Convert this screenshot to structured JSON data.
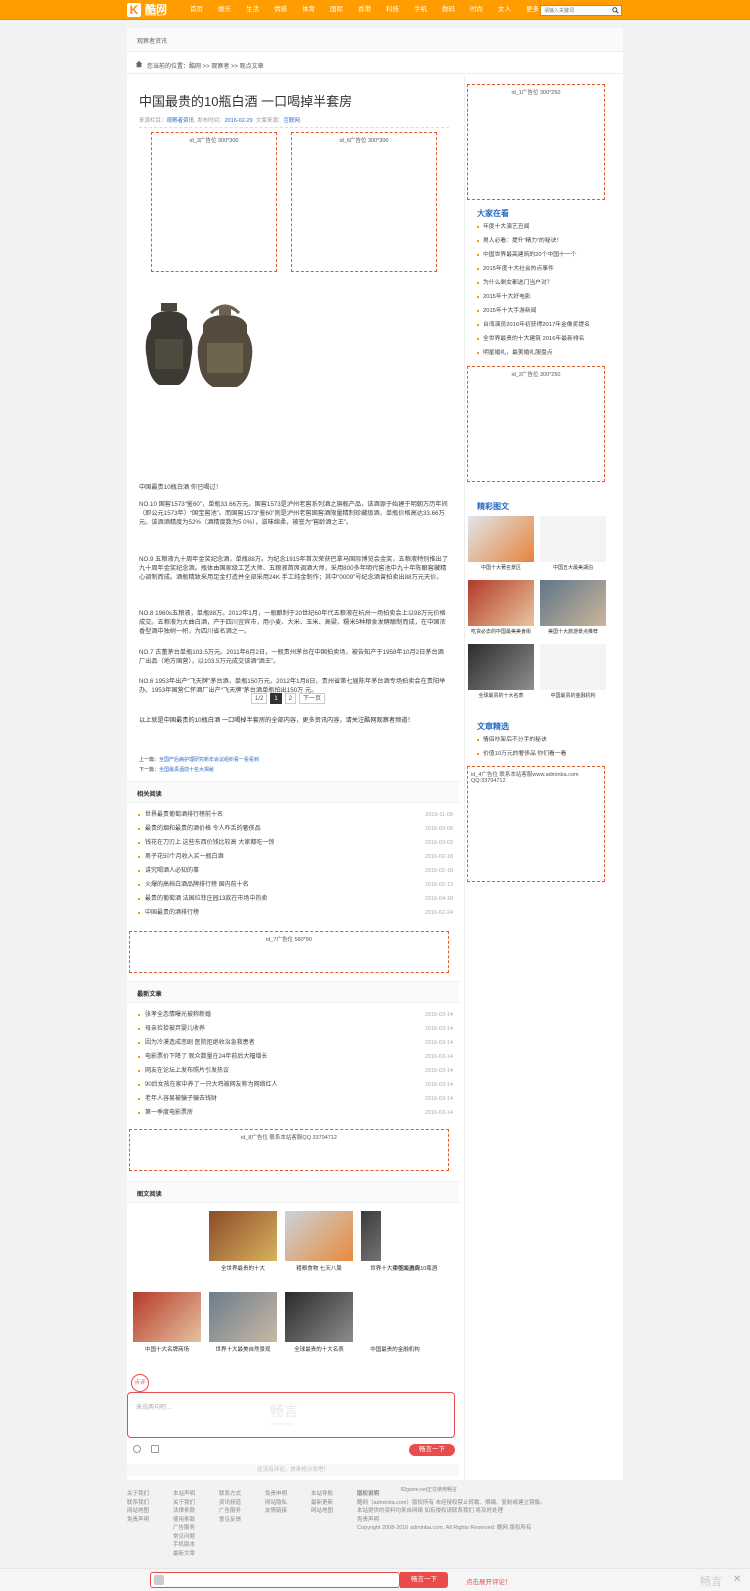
{
  "header": {
    "logo_mark": "K",
    "logo_text": "酷网",
    "logo_sub": "kuwoli.com",
    "nav": [
      "首页",
      "娱乐",
      "生活",
      "情感",
      "体育",
      "国际",
      "香港",
      "科技",
      "手机",
      "数码",
      "时尚",
      "女人",
      "更多 ▾"
    ],
    "search_placeholder": "请输入关键词"
  },
  "breadcrumb_bar": "观察者资讯",
  "position": "您当前的位置：酷网 >> 观察者 >> 观点文章",
  "article": {
    "title": "中国最贵的10瓶白酒 一口喝掉半套房",
    "meta_pre": "来源栏目：",
    "meta_column": "观察者资讯",
    "meta_mid": "发布时间：",
    "meta_date": "2016-02-29",
    "meta_src_label": "文章来源：",
    "meta_src": "互联网",
    "ad_left": "id_3广告位 300*300",
    "ad_right": "id_6广告位 300*300",
    "paragraphs": [
      "中国最贵10瓶白酒 你已喝过！",
      "NO.10 国窖1573“鉴60”，单瓶33.66万元。国窖1573是泸州老窖系列酒之旗舰产品，该酒源于始建于明朝万历年间（即公元1573年）“国宝窖池”。而国窖1573“鉴60”则是泸州老窖国窖酒限量精制珍藏级酒，单瓶价格高达33.66万元。该酒酒精度为52%（酒精度数为5 0%），滋味绵柔，被誉为“窖龄酒之王”。",
      "NO.9 五粮液九十周年金奖纪念酒，单瓶88万。为纪念1915年首次荣获巴拿马国际博览会金奖，五粮液特别推出了九十周年金奖纪念酒。瓶体由国家级工艺大师、五粮液首席调酒大师，采用800多年明代窖池中九十年陈酿窖藏精心调制而成。酒瓶精致采用足金打造并全部采用24K 手工纯金制作；其中“0009”号纪念酒曾拍卖出88万元天价。",
      "NO.8 1960s五粮液，单瓶98万。2012年1月，一瓶酿制于20世纪60年代五粮液在杭州一场拍卖会上以98万元价格成交。五粮液为大曲白酒，产于四川宜宾市，用小麦、大米、玉米、高粱、糯米5种粮食发酵酿制而成，在中国浓香型酒中独树一帜，为四川省名酒之一。",
      "NO.7 古董茅台单瓶103.5万元。2011年6月2日，一瓶贵州茅台在中国拍卖场，被告知产于1958年10月2日茅台酒厂出品（地方国营），以103.5万元成交该酒“酒王”。",
      "NO.6 1953年出产“飞天牌”茅台酒，单瓶150万元。2012年1月8日，贵州省第七届陈年茅台酒专场拍卖会在贵阳举办。1953年国营仁怀酒厂出产“飞天牌”茅台酒单瓶拍出150万 元。"
    ],
    "pager": [
      "1/2",
      "1",
      "2",
      "下一页"
    ],
    "summary": "以上就是中国最贵的10瓶白酒 一口喝掉半套房的全部内容，更多资讯内容，请关注酷网观察者频道！",
    "prev_label": "上一篇：",
    "prev": "全国产后病护理研究新年会议组织看一看看到",
    "next_label": "下一篇：",
    "next": "全国最贵酒前十名大揭秘"
  },
  "related": {
    "title": "相关阅读",
    "items": [
      {
        "t": "世界最贵葡萄酒排行榜前十名",
        "d": "2016-11-09"
      },
      {
        "t": "最贵的烟和最贵的酒价格 令人咋舌的奢侈品",
        "d": "2016-03-09"
      },
      {
        "t": "钱花在刀刃上 这些东西价钱比较高 大家都吃一惊",
        "d": "2016-03-03"
      },
      {
        "t": "男子花50个月收入买一瓶白酒",
        "d": "2016-02-18"
      },
      {
        "t": "讲究喝酒人必知的事",
        "d": "2016-02-18"
      },
      {
        "t": "火爆的高档白酒品牌排行榜 国内前十名",
        "d": "2016-02-13"
      },
      {
        "t": "最贵的葡萄酒 法国拉菲庄园13款在市场中热卖",
        "d": "2016-04-18"
      },
      {
        "t": "中国最贵的酒排行榜",
        "d": "2016-02-24"
      }
    ],
    "ad": "id_7广告位 580*90"
  },
  "latest": {
    "title": "最新文章",
    "items": [
      {
        "t": "张孝全恋情曝光被称新婚",
        "d": "2016-03-14"
      },
      {
        "t": "母亲捡拾被弃婴儿收养",
        "d": "2016-03-14"
      },
      {
        "t": "因为冷漠造成悲剧 医院拒绝收治急救患者",
        "d": "2016-03-14"
      },
      {
        "t": "电影票价下降了 观众数量在24年前后大幅增长",
        "d": "2016-03-14"
      },
      {
        "t": "网友在论坛上发布照片引发热议",
        "d": "2016-03-14"
      },
      {
        "t": "90后女孩在家中养了一只大鸡被网友称为网络红人",
        "d": "2016-03-14"
      },
      {
        "t": "老年人容易被骗子骗去钱财",
        "d": "2016-03-14"
      },
      {
        "t": "第一季度电影票房",
        "d": "2016-03-14"
      }
    ],
    "ad": "id_8广告位 联系本站客服QQ 33794712"
  },
  "gallery": {
    "title": "图文阅读",
    "items": [
      "全世界最贵的十大",
      "粗粮食物 七天八周",
      "世界十大豪华大酒店",
      "中国最贵的10瓶酒",
      "中国十大名牌商场",
      "世界十大最美自然景观",
      "全球最贵的十大名表",
      "中国最贵的金融机构"
    ]
  },
  "comment": {
    "label": "点评",
    "placeholder": "来说两句吧...",
    "watermark": "畅言",
    "watermark_sub": "CHANGYAN",
    "submit": "畅言一下",
    "empty": "还没有评论，快来抢沙发吧！",
    "brand": "92game.net正在使用畅言"
  },
  "sidebar": {
    "ad_top": "id_1广告位 300*250",
    "hot_title": "大家在看",
    "hot_items": [
      "年度十大演艺丑闻",
      "男人必看：提升“精力”的秘诀！",
      "中国世界最高建筑的20个中国十一个",
      "2015年度十大社会热点事件",
      "为什么剩女都选门当户对？",
      "2015年十大好电影",
      "2015年十大手游新闻",
      "台湾演员2016年初获得2017年金像奖提名",
      "全世界最贵的十大建筑 2016年最新排名",
      "明星婚礼，最美婚礼服盘点"
    ],
    "ad_mid": "id_2广告位 300*250",
    "pics_title": "精彩图文",
    "pics": [
      "中国十大著名景区",
      "中国五大最美湖泊",
      "吃货必去的中国最美美食街",
      "美国十大旅游景点推荐",
      "全球最贵的十大名表",
      "中国最贵的金融机构"
    ],
    "select_title": "文章精选",
    "select_items": [
      "情侣吵架后不分手的秘诀",
      "价值10万元的奢侈品 你们看一看"
    ],
    "ad_bottom": "id_4广告位 联系本站客服www.adminba.com QQ:33794712"
  },
  "footer": {
    "cols": [
      [
        "关于我们",
        "联系我们",
        "网站地图",
        "免责声明"
      ],
      [
        "本站声明",
        "关于我们",
        "法律条款",
        "使用条款",
        "广告服务",
        "常见问题",
        "手机版本",
        "最新文章"
      ],
      [
        "联系方式",
        "资讯频道",
        "广告服务",
        "意见反馈"
      ],
      [
        "免责申明",
        "网站隐私",
        "友情链接"
      ],
      [
        "本站导航",
        "最新更新",
        "网站地图"
      ]
    ],
    "copyright_title": "版权说明",
    "copyright_lines": [
      "酷网（adminba.com）版权所有 未经授权禁止转载、摘编、复制或建立镜像。",
      "本站提供的资料均来自网络 如有侵权请联系我们 将及时处理",
      "免责声明",
      "Copyright 2008-2016 adminba.com. All Rights Reserved. 酷网 版权所有"
    ]
  },
  "bottombar": {
    "submit": "畅言一下",
    "tip": "点击展开评论！",
    "brand": "畅言"
  }
}
